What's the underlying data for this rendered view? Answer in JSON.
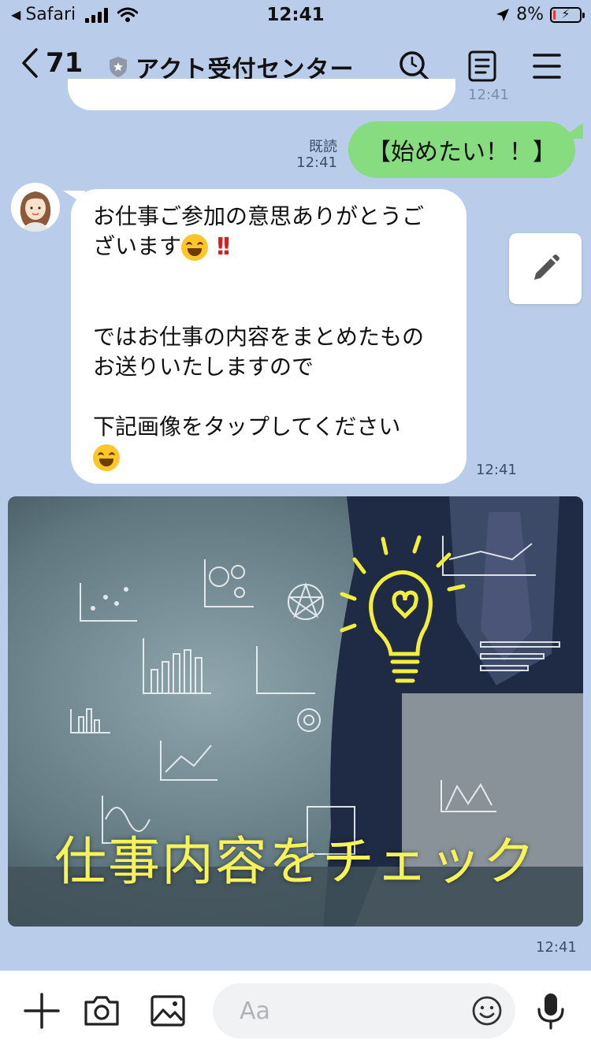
{
  "status_bar": {
    "back_app": "Safari",
    "time": "12:41",
    "battery_percent": "8%",
    "battery_level": 0.08
  },
  "header": {
    "back_count": "71",
    "title": "アクト受付センター"
  },
  "chat": {
    "prev_time": "12:41",
    "outgoing": {
      "read_label": "既読",
      "time": "12:41",
      "text": "【始めたい！！】"
    },
    "incoming": {
      "line1": "お仕事ご参加の意思ありがとうご",
      "line2": "ざいます",
      "para2": "ではお仕事の内容をまとめたもの\nお送りいたしますので",
      "para3": "下記画像をタップしてください",
      "time": "12:41"
    },
    "image": {
      "caption": "仕事内容をチェック",
      "time": "12:41"
    }
  },
  "input_bar": {
    "placeholder": "Aa"
  },
  "colors": {
    "background": "#b9cdea",
    "outgoing_bubble": "#86dc7e",
    "incoming_bubble": "#ffffff",
    "image_caption": "#f6f25a"
  }
}
